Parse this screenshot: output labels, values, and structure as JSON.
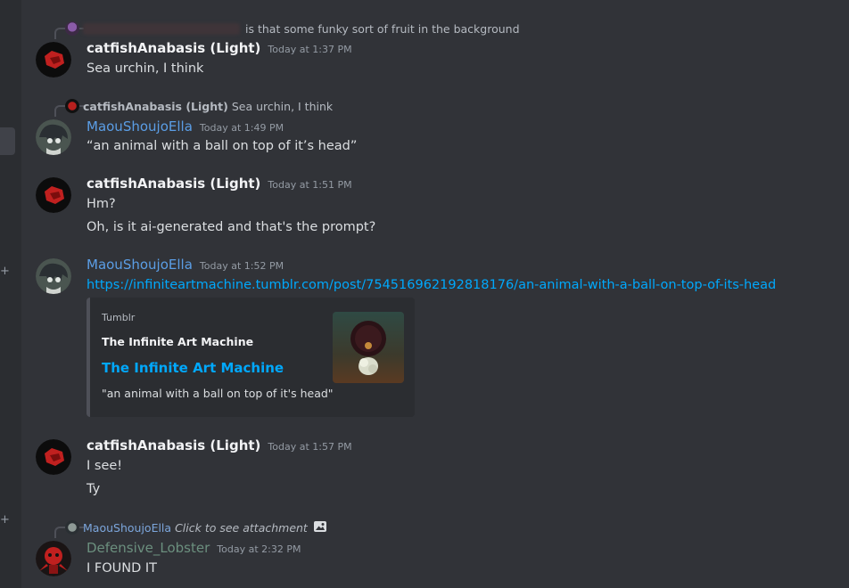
{
  "messages": [
    {
      "reply": {
        "text": "is that some funky sort of fruit in the background"
      },
      "author": "catfishAnabasis (Light)",
      "timestamp": "Today at 1:37 PM",
      "lines": [
        "Sea urchin, I think"
      ]
    },
    {
      "reply": {
        "author": "catfishAnabasis (Light)",
        "text": "Sea urchin, I think"
      },
      "author": "MaouShoujoElla",
      "timestamp": "Today at 1:49 PM",
      "lines": [
        "“an animal with a ball on top of it’s head”"
      ]
    },
    {
      "author": "catfishAnabasis (Light)",
      "timestamp": "Today at 1:51 PM",
      "lines": [
        "Hm?",
        "Oh, is it ai-generated and that's the prompt?"
      ]
    },
    {
      "author": "MaouShoujoElla",
      "timestamp": "Today at 1:52 PM",
      "link": "https://infiniteartmachine.tumblr.com/post/754516962192818176/an-animal-with-a-ball-on-top-of-its-head",
      "embed": {
        "provider": "Tumblr",
        "author": "The Infinite Art Machine",
        "title": "The Infinite Art Machine",
        "description": "\"an animal with a ball on top of it's head\""
      }
    },
    {
      "author": "catfishAnabasis (Light)",
      "timestamp": "Today at 1:57 PM",
      "lines": [
        "I see!",
        "Ty"
      ]
    },
    {
      "reply": {
        "author": "MaouShoujoElla",
        "text": "Click to see attachment"
      },
      "author": "Defensive_Lobster",
      "timestamp": "Today at 2:32 PM",
      "lines": [
        "I FOUND IT"
      ]
    }
  ],
  "colors": {
    "background": "#313338",
    "link": "#00a8fc",
    "ella_name": "#5b9ee6",
    "lobster_name": "#6b8f7e"
  }
}
